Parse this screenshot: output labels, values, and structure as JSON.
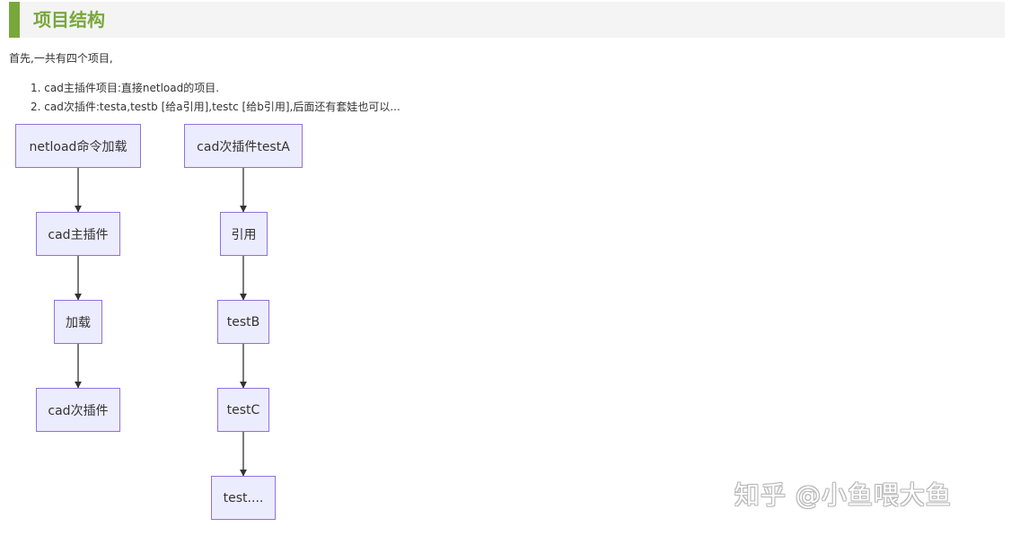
{
  "section": {
    "heading": "项目结构",
    "intro": "首先,一共有四个项目,",
    "items": [
      "1. cad主插件项目:直接netload的项目.",
      "2. cad次插件:testa,testb [给a引用],testc [给b引用],后面还有套娃也可以..."
    ]
  },
  "flowchart": {
    "left_chain": [
      "netload命令加载",
      "cad主插件",
      "加载",
      "cad次插件"
    ],
    "right_chain": [
      "cad次插件testA",
      "引用",
      "testB",
      "testC",
      "test...."
    ]
  },
  "watermark": "知乎 @小鱼喂大鱼",
  "colors": {
    "heading_accent": "#78a83a",
    "node_fill": "#ececff",
    "node_border": "#9370db",
    "arrow": "#333333"
  }
}
